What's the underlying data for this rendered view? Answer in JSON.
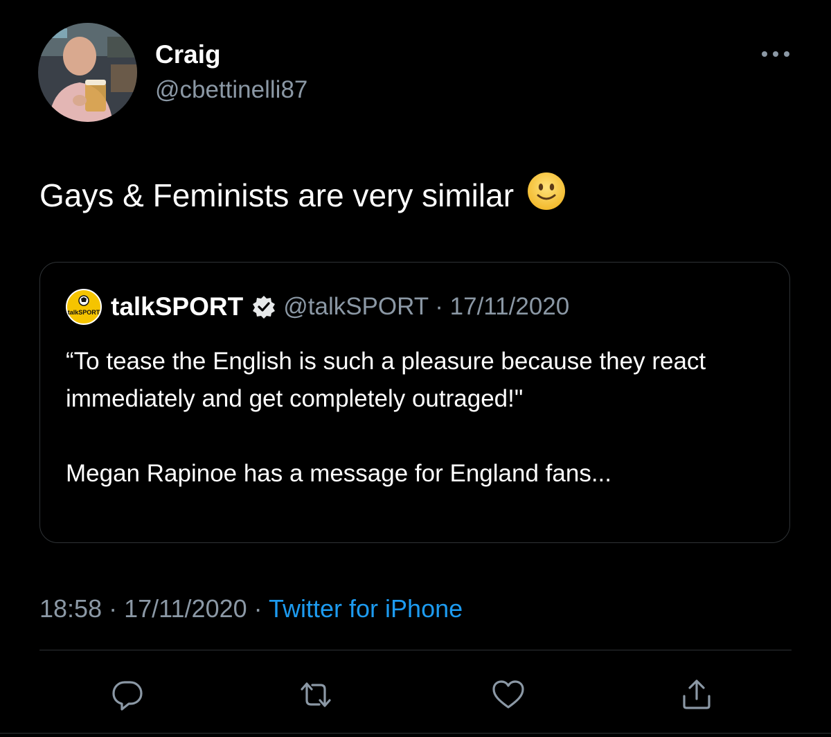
{
  "author": {
    "display_name": "Craig",
    "handle": "@cbettinelli87"
  },
  "tweet": {
    "text": "Gays & Feminists are very similar",
    "emoji": "slightly-smiling-face-icon"
  },
  "quoted_tweet": {
    "name": "talkSPORT",
    "handle": "@talkSPORT",
    "separator": "·",
    "date": "17/11/2020",
    "logo_text": "talkSPORT",
    "verified": true,
    "body": "“To tease the English is such a pleasure because they react immediately and get completely outraged!\"\n\nMegan Rapinoe has a message for England fans..."
  },
  "meta": {
    "time": "18:58",
    "sep1": "·",
    "date": "17/11/2020",
    "sep2": "·",
    "source": "Twitter for iPhone"
  },
  "actions": {
    "icons": [
      "reply-icon",
      "retweet-icon",
      "like-icon",
      "share-icon"
    ]
  },
  "colors": {
    "background": "#000000",
    "text": "#ffffff",
    "secondary": "#8b98a5",
    "link": "#1d9bf0",
    "border": "#2f3336"
  }
}
